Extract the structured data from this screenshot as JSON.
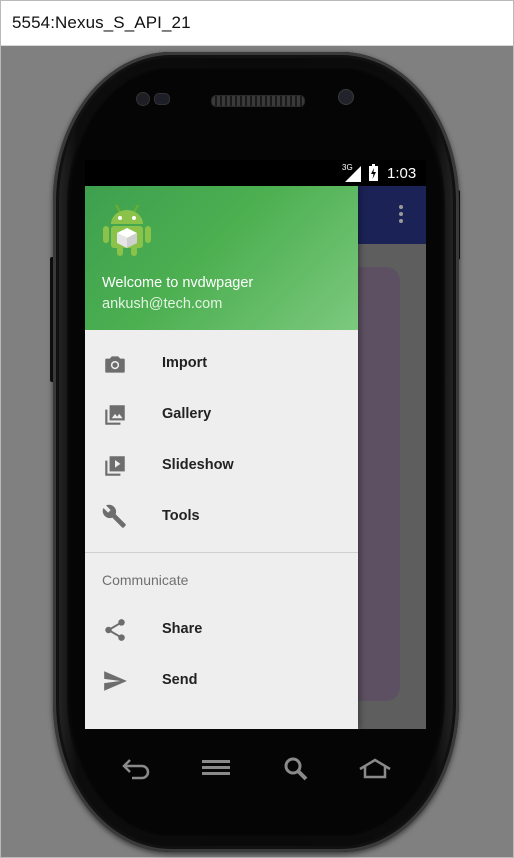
{
  "window": {
    "title": "5554:Nexus_S_API_21"
  },
  "status_bar": {
    "network": "3G",
    "time": "1:03"
  },
  "drawer": {
    "header": {
      "welcome": "Welcome to nvdwpager",
      "email": "ankush@tech.com",
      "avatar_icon": "android-robot-icon",
      "gradient_colors": [
        "#3ea04f",
        "#7cc97e"
      ]
    },
    "items": [
      {
        "label": "Import",
        "icon": "camera-icon"
      },
      {
        "label": "Gallery",
        "icon": "gallery-icon"
      },
      {
        "label": "Slideshow",
        "icon": "slideshow-icon"
      },
      {
        "label": "Tools",
        "icon": "wrench-icon"
      }
    ],
    "section": {
      "title": "Communicate",
      "items": [
        {
          "label": "Share",
          "icon": "share-icon"
        },
        {
          "label": "Send",
          "icon": "send-icon"
        }
      ]
    }
  },
  "app_bar": {
    "color": "#1b2356",
    "menu_icon": "overflow-menu-icon"
  },
  "hardware_buttons": [
    "back-icon",
    "menu-icon",
    "search-icon",
    "home-icon"
  ]
}
